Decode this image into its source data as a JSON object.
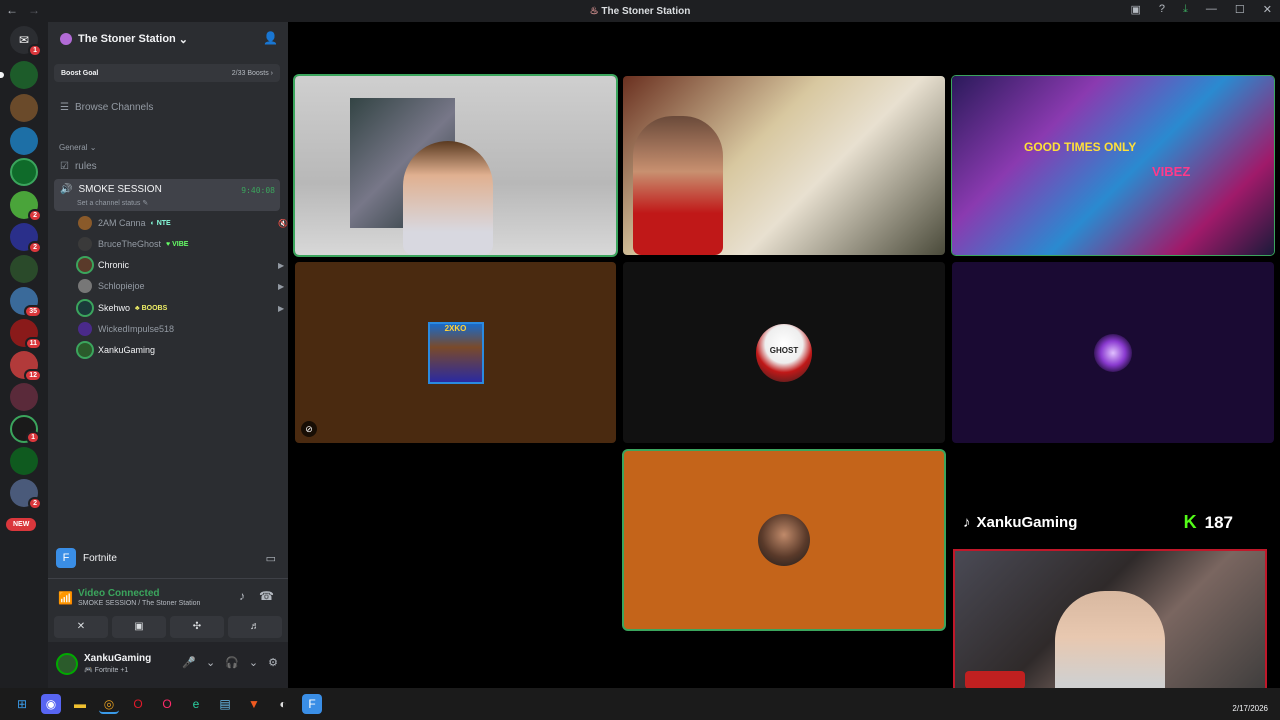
{
  "titlebar": {
    "title": "The Stoner Station"
  },
  "servers": {
    "badges": [
      "1",
      "2",
      "2",
      "35",
      "11",
      "12",
      "1",
      "2"
    ],
    "new_label": "NEW"
  },
  "guild": {
    "name": "The Stoner Station",
    "boost_label": "Boost Goal",
    "boost_count": "2/33 Boosts"
  },
  "sidebar": {
    "browse_label": "Browse Channels",
    "category": "General",
    "channel_rules": "rules",
    "voice_channel": {
      "name": "SMOKE SESSION",
      "status": "Set a channel status",
      "timer": "9:40:08"
    },
    "users": [
      {
        "name": "2AM Canna",
        "tag": "NTE"
      },
      {
        "name": "BruceTheGhost",
        "tag": "VIBE"
      },
      {
        "name": "Chronic",
        "tag": ""
      },
      {
        "name": "Schlopiejoe",
        "tag": ""
      },
      {
        "name": "Skehwo",
        "tag": "BOOBS"
      },
      {
        "name": "WickedImpulse518",
        "tag": ""
      },
      {
        "name": "XankuGaming",
        "tag": ""
      }
    ]
  },
  "activity": {
    "game": "Fortnite"
  },
  "rtc": {
    "status": "Video Connected",
    "location": "SMOKE SESSION / The Stoner Station"
  },
  "userpanel": {
    "name": "XankuGaming",
    "status": "Fortnite +1"
  },
  "overlay": {
    "tiktok_name": "XankuGaming",
    "kick_count": "187"
  },
  "tiles": {
    "t4_label": "2XKO",
    "t5_label": "GHOST",
    "t3_banner": "GOOD TIMES ONLY",
    "t3_vibez": "VIBEZ"
  },
  "taskbar": {
    "clock": "2/17/2026"
  },
  "colors": {
    "speaking": "#3ba55d",
    "tile_brown": "#4a2a10",
    "tile_orange": "#c4641a",
    "tile_purple": "#1a0a33",
    "tile_dark": "#111111"
  }
}
